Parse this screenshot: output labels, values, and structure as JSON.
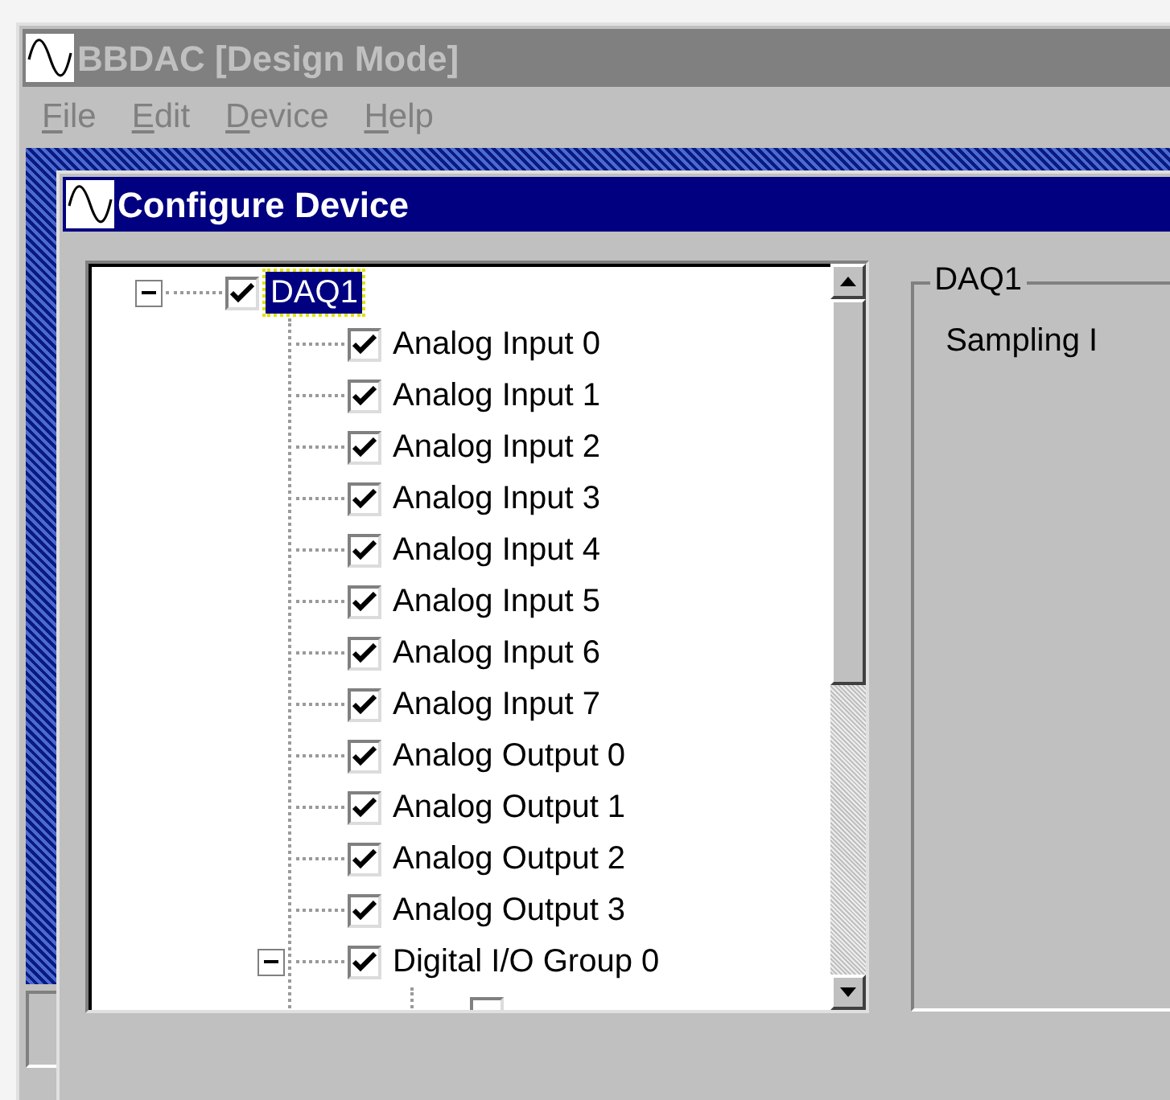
{
  "app_window": {
    "title": "BBDAC [Design Mode]",
    "active": false
  },
  "menu": [
    {
      "label": "File"
    },
    {
      "label": "Edit"
    },
    {
      "label": "Device"
    },
    {
      "label": "Help"
    }
  ],
  "dialog": {
    "title": "Configure Device",
    "active": true
  },
  "tree": [
    {
      "label": "DAQ1",
      "checked": true,
      "selected": true,
      "expanded": true,
      "children": [
        {
          "label": "Analog Input 0",
          "checked": true,
          "selected": false
        },
        {
          "label": "Analog Input 1",
          "checked": true,
          "selected": false
        },
        {
          "label": "Analog Input 2",
          "checked": true,
          "selected": false
        },
        {
          "label": "Analog Input 3",
          "checked": true,
          "selected": false
        },
        {
          "label": "Analog Input 4",
          "checked": true,
          "selected": false
        },
        {
          "label": "Analog Input 5",
          "checked": true,
          "selected": false
        },
        {
          "label": "Analog Input 6",
          "checked": true,
          "selected": false
        },
        {
          "label": "Analog Input 7",
          "checked": true,
          "selected": false
        },
        {
          "label": "Analog Output 0",
          "checked": true,
          "selected": false
        },
        {
          "label": "Analog Output 1",
          "checked": true,
          "selected": false
        },
        {
          "label": "Analog Output 2",
          "checked": true,
          "selected": false
        },
        {
          "label": "Analog Output 3",
          "checked": true,
          "selected": false
        },
        {
          "label": "Digital I/O Group 0",
          "checked": true,
          "selected": false,
          "expanded": true,
          "children": [
            {
              "checked": false
            }
          ]
        }
      ]
    }
  ],
  "group_box": {
    "title": "DAQ1",
    "label": "Sampling I"
  }
}
